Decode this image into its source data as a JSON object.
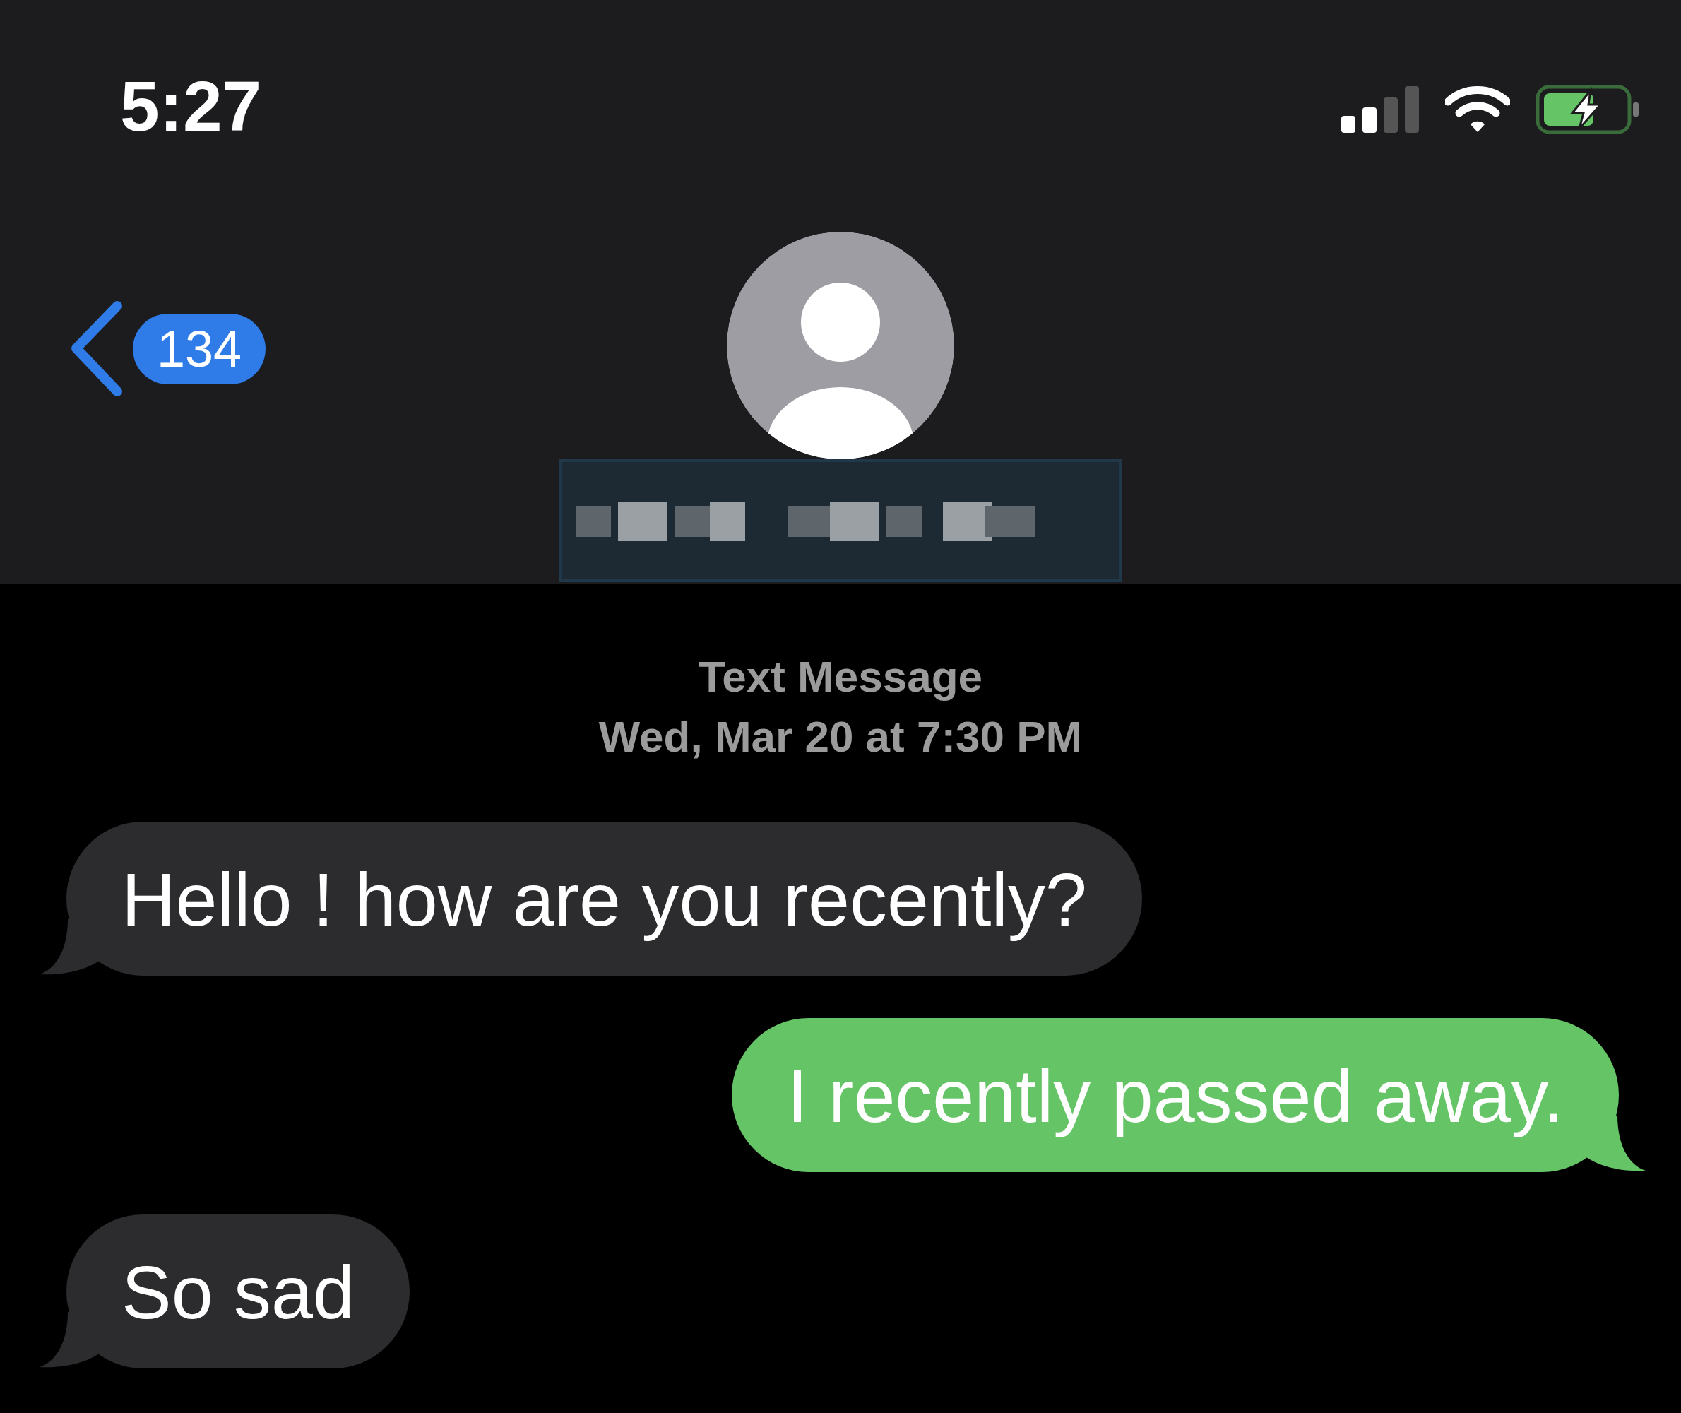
{
  "status_bar": {
    "time": "5:27",
    "charging": true
  },
  "header": {
    "back_badge": "134",
    "contact_name": {
      "redacted": true
    }
  },
  "thread": {
    "service": "Text Message",
    "timestamp": "Wed, Mar 20 at 7:30 PM"
  },
  "messages": [
    {
      "kind": "incoming",
      "text": "Hello ! how are you recently?"
    },
    {
      "kind": "outgoing",
      "text": "I recently passed away."
    },
    {
      "kind": "incoming",
      "text": "So sad"
    }
  ]
}
